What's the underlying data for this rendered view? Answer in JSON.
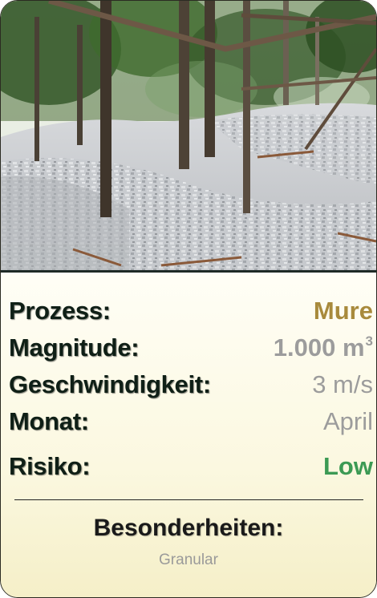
{
  "card": {
    "photo": {
      "subject": "forest-slope-with-grey-debris",
      "colors": {
        "sky": "#e9efe2",
        "foliage": "#3d5f2c",
        "debris": "#c9ccd0",
        "trunk": "#5a4a3a"
      }
    },
    "rows": {
      "process": {
        "label": "Prozess:",
        "value": "Mure",
        "color": "#a88a3c"
      },
      "magnitude": {
        "label": "Magnitude:",
        "value": "1.000 m",
        "unit_sup": "3",
        "color": "#9c9c9c"
      },
      "speed": {
        "label": "Geschwindigkeit:",
        "value": "3 m/s",
        "color": "#9c9c9c"
      },
      "month": {
        "label": "Monat:",
        "value": "April",
        "color": "#9c9c9c"
      },
      "risk": {
        "label": "Risiko:",
        "value": "Low",
        "color": "#3c9a54"
      }
    },
    "special": {
      "title": "Besonderheiten:",
      "value": "Granular"
    }
  }
}
